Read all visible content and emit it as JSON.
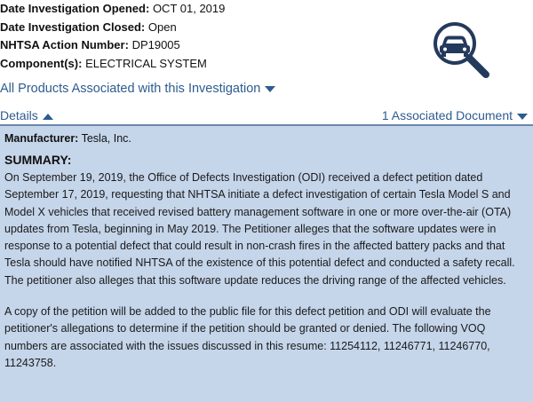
{
  "meta": {
    "opened_label": "Date Investigation Opened:",
    "opened_value": "OCT 01, 2019",
    "closed_label": "Date Investigation Closed:",
    "closed_value": "Open",
    "action_label": "NHTSA Action Number:",
    "action_value": "DP19005",
    "component_label": "Component(s):",
    "component_value": "ELECTRICAL SYSTEM"
  },
  "icon": {
    "name": "car-magnifier-icon",
    "color": "#243a5c"
  },
  "links": {
    "all_products": "All Products Associated with this Investigation"
  },
  "tabs": {
    "details": "Details",
    "documents": "1 Associated Document"
  },
  "details": {
    "manufacturer_label": "Manufacturer:",
    "manufacturer_value": "Tesla, Inc.",
    "summary_heading": "SUMMARY:",
    "paragraph_1": "On September 19, 2019, the Office of Defects Investigation (ODI) received a defect petition dated September 17, 2019, requesting that NHTSA initiate a defect investigation of certain Tesla Model S and Model X vehicles that received revised battery management software in one or more over-the-air (OTA) updates from Tesla, beginning in May 2019. The Petitioner alleges that the software updates were in response to a potential defect that could result in non-crash fires in the affected battery packs and that Tesla should have notified NHTSA of the existence of this potential defect and conducted a safety recall. The petitioner also alleges that this software update reduces the driving range of the affected vehicles.",
    "paragraph_2": "A copy of the petition will be added to the public file for this defect petition and ODI will evaluate the petitioner's allegations to determine if the petition should be granted or denied. The following VOQ numbers are associated with the issues discussed in this resume: 11254112, 11246771, 11246770, 11243758."
  },
  "colors": {
    "link": "#2d5c8f",
    "panel_bg": "#c5d5ea",
    "divider": "#6a86ad"
  }
}
